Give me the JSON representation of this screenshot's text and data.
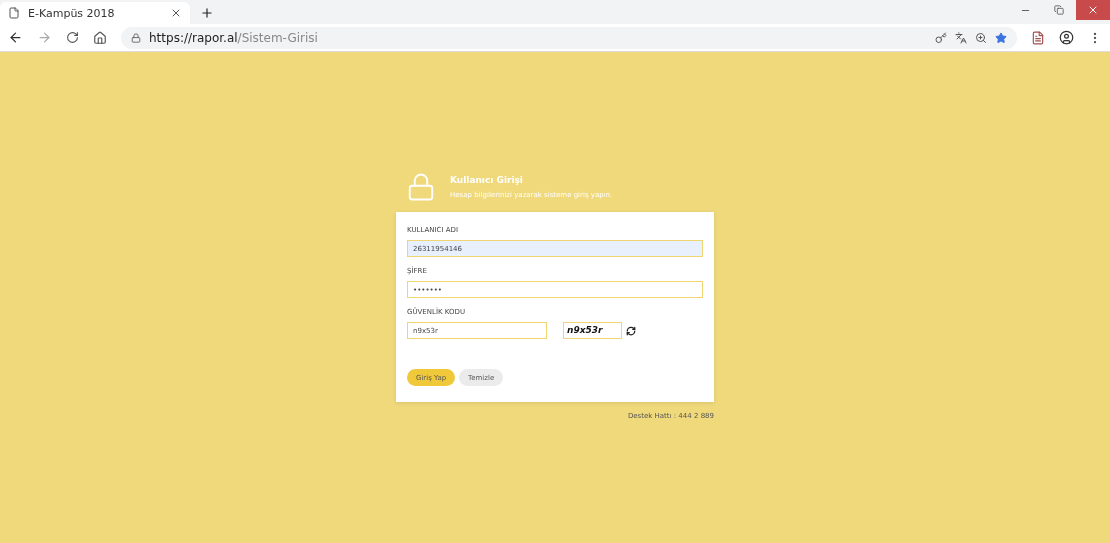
{
  "browser": {
    "tab_title": "E-Kampüs 2018",
    "url_host": "https://rapor.al",
    "url_path": "/Sistem-Girisi"
  },
  "login": {
    "title": "Kullanıcı Girişi",
    "subtitle": "Hesap bilgilerinizi yazarak sisteme giriş yapın.",
    "username_label": "KULLANICI ADI",
    "username_value": "26311954146",
    "password_label": "ŞİFRE",
    "password_value": "•••••••",
    "code_label": "GÜVENLİK KODU",
    "code_value": "n9x53r",
    "captcha_text": "n9x53r",
    "buttons": [
      "Giriş Yap",
      "Temizle"
    ]
  },
  "support": "Destek Hattı : 444 2 889"
}
